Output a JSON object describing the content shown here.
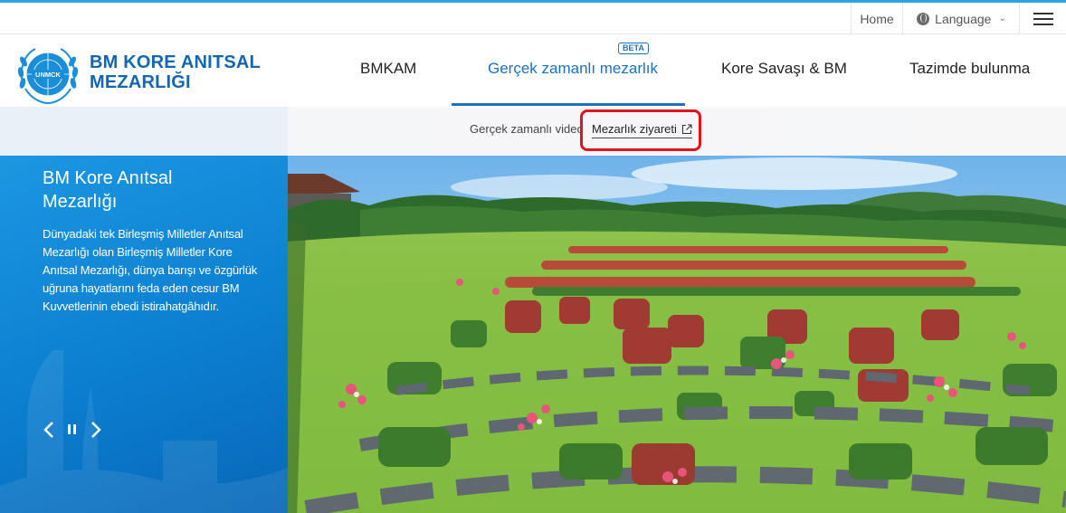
{
  "utility": {
    "home": "Home",
    "language": "Language"
  },
  "brand": {
    "logo_text": "UNMCK",
    "name_line1": "BM KORE ANITSAL",
    "name_line2": "MEZARLIĞI"
  },
  "nav": {
    "items": [
      {
        "label": "BMKAM"
      },
      {
        "label": "Gerçek zamanlı mezarlık",
        "badge": "BETA",
        "active": true
      },
      {
        "label": "Kore Savaşı & BM"
      },
      {
        "label": "Tazimde bulunma"
      }
    ]
  },
  "subnav": {
    "video": "Gerçek zamanlı video",
    "visit": "Mezarlık ziyareti"
  },
  "hero": {
    "title_line1": "BM Kore Anıtsal",
    "title_line2": "Mezarlığı",
    "description": "Dünyadaki tek Birleşmiş Milletler Anıtsal Mezarlığı olan Birleşmiş Milletler Kore Anıtsal Mezarlığı, dünya barışı ve özgürlük uğruna hayatlarını feda eden cesur BM Kuvvetlerinin ebedi istirahatgâhıdır."
  },
  "colors": {
    "accent": "#1a72c0",
    "brand": "#1366b0",
    "panel": "#0c7fd0",
    "highlight": "#e3141c"
  },
  "icons": [
    "globe-icon",
    "chevron-down-icon",
    "menu-icon",
    "external-link-icon",
    "prev-icon",
    "pause-icon",
    "next-icon"
  ]
}
